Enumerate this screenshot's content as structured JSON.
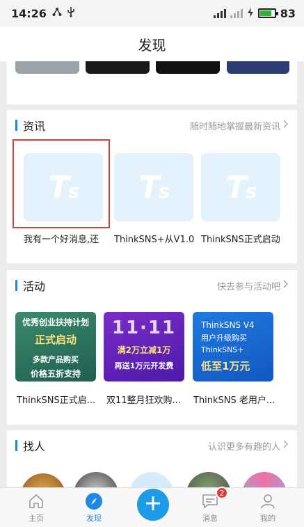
{
  "status_bar": {
    "time": "14:26",
    "battery": "83"
  },
  "header": {
    "title": "发现"
  },
  "news": {
    "title": "资讯",
    "more": "随时随地掌握最新资讯",
    "items": [
      {
        "label": "我有一个好消息,还"
      },
      {
        "label": "ThinkSNS+从V1.0"
      },
      {
        "label": "ThinkSNS正式启动"
      }
    ]
  },
  "events": {
    "title": "活动",
    "more": "快去参与活动吧",
    "items": [
      {
        "label": "ThinkSNS正式启...",
        "img_text1": "优秀创业扶持计划",
        "img_text2": "正式启动",
        "img_text3": "多款产品购买",
        "img_text4": "价格五折支持"
      },
      {
        "label": "双11整月狂欢购...",
        "img_text1": "11·11",
        "img_text2": "满2万立减1万",
        "img_text3": "再送1万元开发费"
      },
      {
        "label": "ThinkSNS 老用户...",
        "img_text1": "ThinkSNS V4",
        "img_text2": "用户升级购买",
        "img_text3": "ThinkSNS+",
        "img_text4": "低至1万元"
      }
    ]
  },
  "people": {
    "title": "找人",
    "more": "认识更多有趣的人"
  },
  "tabbar": {
    "home": "主页",
    "discover": "发现",
    "messages": "消息",
    "messages_badge": "2",
    "mine": "我的"
  },
  "colors": {
    "accent": "#1e88e5",
    "highlight": "#e53935"
  },
  "icons": [
    "usb-icon",
    "signal-icon",
    "charging-icon",
    "battery-icon",
    "chevron-right-icon",
    "home-icon",
    "compass-icon",
    "plus-icon",
    "message-icon",
    "user-icon"
  ]
}
